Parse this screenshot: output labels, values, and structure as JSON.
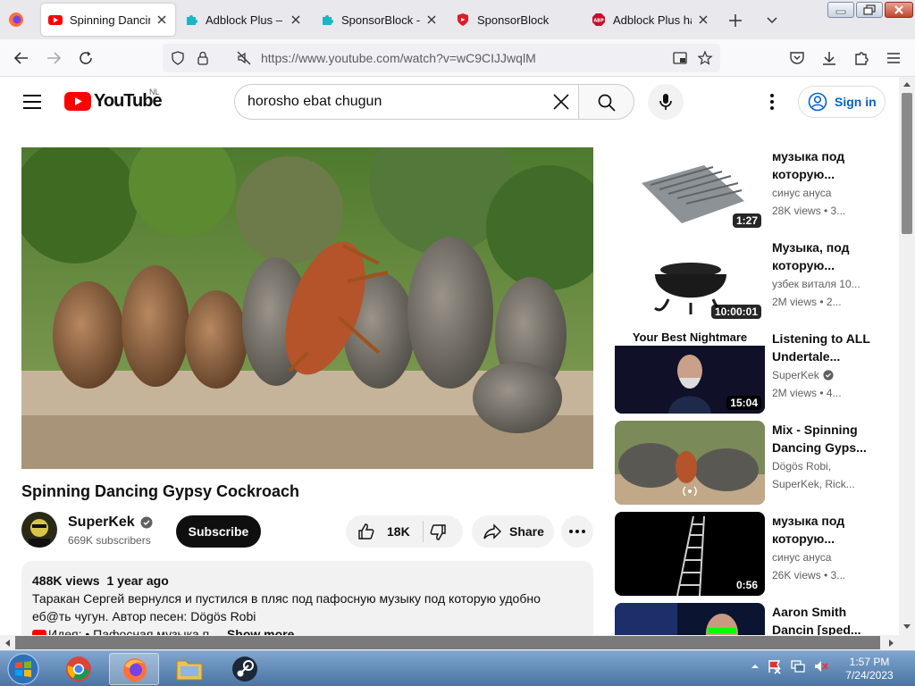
{
  "browser": {
    "tabs": [
      {
        "title": "Spinning Dancing Gypsy Cockroach - YouTube",
        "active": true
      },
      {
        "title": "Adblock Plus – Get this Extension"
      },
      {
        "title": "SponsorBlock - Skip Sponsorships"
      },
      {
        "title": "SponsorBlock"
      },
      {
        "title": "Adblock Plus has been installed"
      }
    ],
    "url": "https://www.youtube.com/watch?v=wC9CIJJwqlM"
  },
  "youtube": {
    "logo_text": "YouTube",
    "region": "NL",
    "search_value": "horosho ebat chugun",
    "signin_label": "Sign in"
  },
  "video": {
    "title": "Spinning Dancing Gypsy Cockroach",
    "channel": "SuperKek",
    "subscribers": "669K subscribers",
    "subscribe_label": "Subscribe",
    "likes": "18K",
    "share_label": "Share",
    "views": "488K views",
    "age": "1 year ago",
    "description": "Таракан Сергей вернулся и пустился в пляс под пафосную музыку под которую удобно еб@ть чугун. Автор песен: Dögös Robi",
    "idea_line": "Идея: • Пафосная музыка п...",
    "show_more": "Show more"
  },
  "recommendations": [
    {
      "title": "музыка под которую...",
      "channel": "синус ануса",
      "views": "28K views • 3...",
      "duration": "1:27",
      "thumb": "roof-sheet"
    },
    {
      "title": "Музыка, под которую...",
      "channel": "узбек виталя 10...",
      "views": "2M views • 2...",
      "duration": "10:00:01",
      "thumb": "cauldron"
    },
    {
      "title": "Listening to ALL Undertale...",
      "channel": "SuperKek",
      "views": "2M views • 4...",
      "duration": "15:04",
      "thumb": "nightmare",
      "thumb_caption": "Your Best Nightmare",
      "verified": true
    },
    {
      "title": "Mix - Spinning Dancing Gyps...",
      "channel": "Dögös Robi,",
      "views": "SuperKek, Rick...",
      "duration": "",
      "thumb": "mix"
    },
    {
      "title": "музыка под которую...",
      "channel": "синус ануса",
      "views": "26K views • 3...",
      "duration": "0:56",
      "thumb": "ladder"
    },
    {
      "title": "Aaron Smith Dancin [sped...",
      "channel": "",
      "views": "",
      "duration": "",
      "thumb": "aaron"
    }
  ],
  "taskbar": {
    "time": "1:57 PM",
    "date": "7/24/2023"
  },
  "colors": {
    "yt_red": "#ff0000",
    "link_blue": "#065fd4",
    "chip_gray": "#f2f2f2"
  }
}
